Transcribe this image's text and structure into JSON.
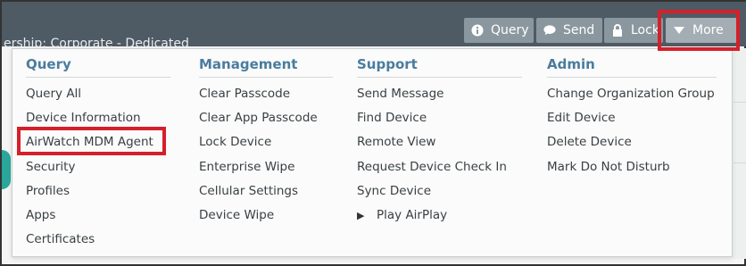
{
  "header": {
    "ownership_text": "ership: Corporate - Dedicated"
  },
  "toolbar": {
    "query_label": "Query",
    "send_label": "Send",
    "lock_label": "Lock",
    "more_label": "More"
  },
  "menu": {
    "query": {
      "title": "Query",
      "items": [
        "Query All",
        "Device Information",
        "AirWatch MDM Agent",
        "Security",
        "Profiles",
        "Apps",
        "Certificates"
      ]
    },
    "management": {
      "title": "Management",
      "items": [
        "Clear Passcode",
        "Clear App Passcode",
        "Lock Device",
        "Enterprise Wipe",
        "Cellular Settings",
        "Device Wipe"
      ]
    },
    "support": {
      "title": "Support",
      "items": [
        "Send Message",
        "Find Device",
        "Remote View",
        "Request Device Check In",
        "Sync Device",
        "Play AirPlay"
      ]
    },
    "admin": {
      "title": "Admin",
      "items": [
        "Change Organization Group",
        "Edit Device",
        "Delete Device",
        "Mark Do Not Disturb"
      ]
    }
  },
  "colors": {
    "header_bg": "#4e5a64",
    "button_bg": "#8b979f",
    "section_title": "#4a7c9e",
    "highlight": "#d4202a"
  }
}
